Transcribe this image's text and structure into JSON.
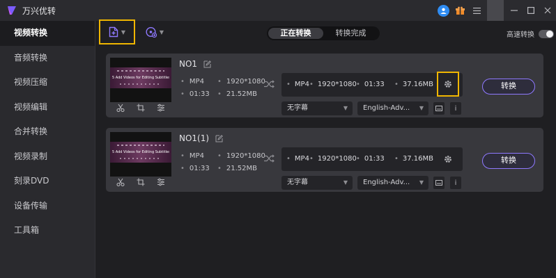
{
  "app": {
    "title": "万兴优转"
  },
  "sidebar": {
    "items": [
      {
        "label": "视频转换",
        "active": true
      },
      {
        "label": "音频转换"
      },
      {
        "label": "视频压缩"
      },
      {
        "label": "视频编辑"
      },
      {
        "label": "合并转换"
      },
      {
        "label": "视频录制"
      },
      {
        "label": "刻录DVD"
      },
      {
        "label": "设备传输"
      },
      {
        "label": "工具箱"
      }
    ]
  },
  "toolbar": {
    "tabs": [
      {
        "label": "正在转换",
        "active": true
      },
      {
        "label": "转换完成"
      }
    ],
    "speed_label": "高速转换",
    "speed_on": false
  },
  "files": [
    {
      "name": "NO1",
      "thumb_text": "5 Add Videos for Editing Subtitles",
      "source": {
        "format": "MP4",
        "resolution": "1920*1080",
        "duration": "01:33",
        "size": "21.52MB"
      },
      "target": {
        "format": "MP4",
        "resolution": "1920*1080",
        "duration": "01:33",
        "size": "37.16MB"
      },
      "subtitle": "无字幕",
      "audio": "English-Adv...",
      "convert_label": "转换"
    },
    {
      "name": "NO1(1)",
      "thumb_text": "5 Add Videos for Editing Subtitles",
      "source": {
        "format": "MP4",
        "resolution": "1920*1080",
        "duration": "01:33",
        "size": "21.52MB"
      },
      "target": {
        "format": "MP4",
        "resolution": "1920*1080",
        "duration": "01:33",
        "size": "37.16MB"
      },
      "subtitle": "无字幕",
      "audio": "English-Adv...",
      "convert_label": "转换"
    }
  ],
  "colors": {
    "accent": "#8f79ff",
    "highlight": "#f0b600",
    "avatar": "#2f8cf2",
    "gift": "#f08b2a"
  }
}
